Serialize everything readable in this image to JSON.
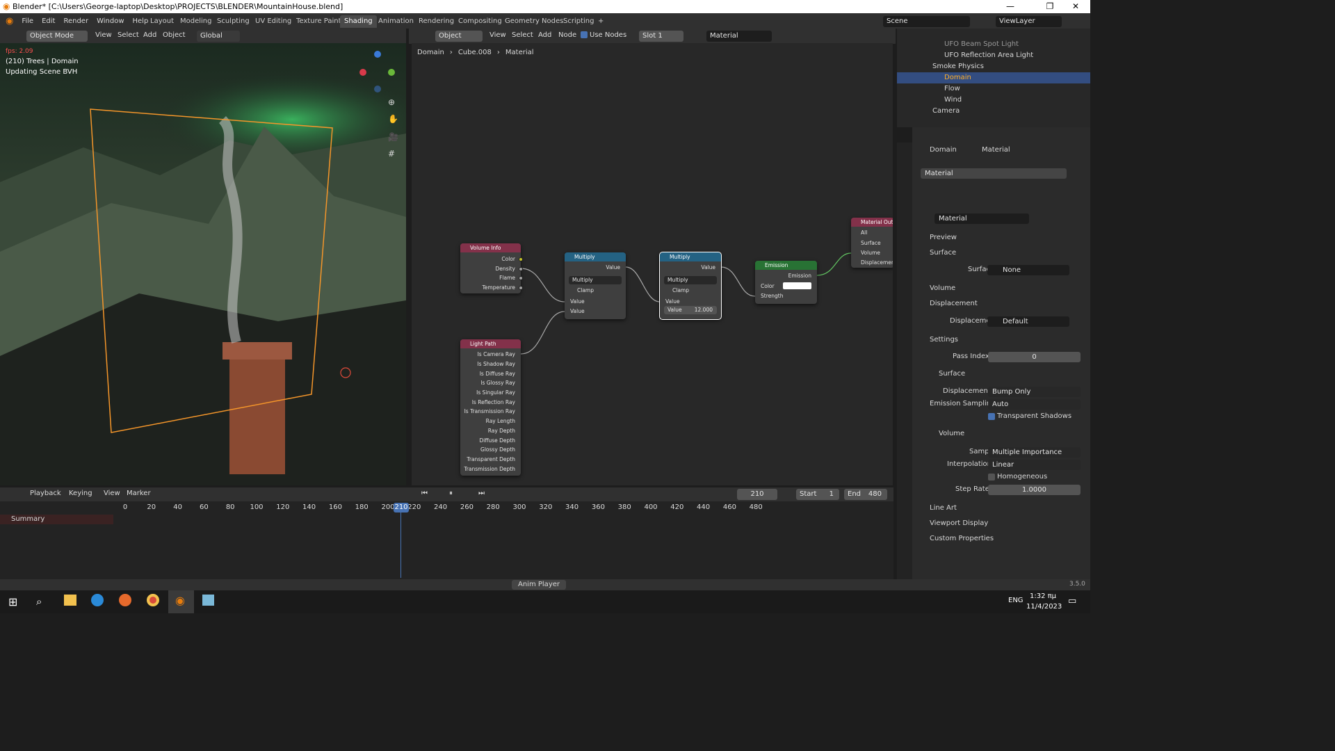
{
  "window": {
    "title": "Blender* [C:\\Users\\George-laptop\\Desktop\\PROJECTS\\BLENDER\\MountainHouse.blend]",
    "min": "—",
    "max": "❐",
    "close": "✕"
  },
  "menus": [
    "File",
    "Edit",
    "Render",
    "Window",
    "Help"
  ],
  "workspaces": [
    "Layout",
    "Modeling",
    "Sculpting",
    "UV Editing",
    "Texture Paint",
    "Shading",
    "Animation",
    "Rendering",
    "Compositing",
    "Geometry Nodes",
    "Scripting",
    "+"
  ],
  "active_workspace": "Shading",
  "top_right": {
    "scene": "Scene",
    "view_layer": "ViewLayer"
  },
  "viewport": {
    "mode": "Object Mode",
    "menu": [
      "View",
      "Select",
      "Add",
      "Object"
    ],
    "transform": "Global",
    "fps": "fps: 2.09",
    "info1": "(210) Trees | Domain",
    "info2": "Updating Scene BVH"
  },
  "node_editor": {
    "object_type": "Object",
    "menu": [
      "View",
      "Select",
      "Add",
      "Node"
    ],
    "use_nodes": "Use Nodes",
    "slot": "Slot 1",
    "material": "Material",
    "breadcrumb": [
      "Domain",
      "Cube.008",
      "Material"
    ],
    "nodes": {
      "volume_info": {
        "title": "Volume Info",
        "outputs": [
          "Color",
          "Density",
          "Flame",
          "Temperature"
        ]
      },
      "light_path": {
        "title": "Light Path",
        "outputs": [
          "Is Camera Ray",
          "Is Shadow Ray",
          "Is Diffuse Ray",
          "Is Glossy Ray",
          "Is Singular Ray",
          "Is Reflection Ray",
          "Is Transmission Ray",
          "Ray Length",
          "Ray Depth",
          "Diffuse Depth",
          "Glossy Depth",
          "Transparent Depth",
          "Transmission Depth"
        ]
      },
      "multiply1": {
        "title": "Multiply",
        "out": "Value",
        "op": "Multiply",
        "clamp": "Clamp",
        "in1": "Value",
        "in2": "Value"
      },
      "multiply2": {
        "title": "Multiply",
        "out": "Value",
        "op": "Multiply",
        "clamp": "Clamp",
        "in1": "Value",
        "in2_label": "Value",
        "in2_value": "12.000"
      },
      "emission": {
        "title": "Emission",
        "out": "Emission",
        "color": "Color",
        "strength": "Strength"
      },
      "output": {
        "title": "Material Output",
        "target": "All",
        "surface": "Surface",
        "volume": "Volume",
        "displacement": "Displacement"
      }
    }
  },
  "outliner": {
    "items": [
      {
        "name": "UFO Beam Spot Light"
      },
      {
        "name": "UFO Reflection Area Light"
      },
      {
        "name": "Smoke Physics"
      },
      {
        "name": "Domain"
      },
      {
        "name": "Flow"
      },
      {
        "name": "Wind"
      },
      {
        "name": "Camera"
      }
    ]
  },
  "properties": {
    "breadcrumb": [
      "Domain",
      "Material"
    ],
    "slot_name": "Material",
    "material_name": "Material",
    "panels": {
      "preview": "Preview",
      "surface": "Surface",
      "surface_label": "Surface",
      "surface_value": "None",
      "volume": "Volume",
      "displacement": "Displacement",
      "displacement_label": "Displacement",
      "displacement_value": "Default",
      "settings": "Settings",
      "pass_index_label": "Pass Index",
      "pass_index": "0",
      "sub_surface": "Surface",
      "disp_method_label": "Displacement",
      "disp_method": "Bump Only",
      "emission_sampling_label": "Emission Sampling",
      "emission_sampling": "Auto",
      "transparent_shadows": "Transparent Shadows",
      "sub_volume": "Volume",
      "sampling_label": "Sampling",
      "sampling": "Multiple Importance",
      "interpolation_label": "Interpolation",
      "interpolation": "Linear",
      "homogeneous": "Homogeneous",
      "step_rate_label": "Step Rate",
      "step_rate": "1.0000",
      "line_art": "Line Art",
      "viewport_display": "Viewport Display",
      "custom_properties": "Custom Properties"
    }
  },
  "timeline": {
    "menu": [
      "Playback",
      "Keying",
      "View",
      "Marker"
    ],
    "current_frame": "210",
    "start_label": "Start",
    "start": "1",
    "end_label": "End",
    "end": "480",
    "summary": "Summary",
    "ticks": [
      "0",
      "20",
      "40",
      "60",
      "80",
      "100",
      "120",
      "140",
      "160",
      "180",
      "200",
      "220",
      "240",
      "260",
      "280",
      "300",
      "320",
      "340",
      "360",
      "380",
      "400",
      "420",
      "440",
      "460",
      "480"
    ]
  },
  "status": {
    "anim_player": "Anim Player",
    "version": "3.5.0"
  },
  "taskbar": {
    "lang": "ENG",
    "time": "1:32 πμ",
    "date": "11/4/2023"
  }
}
